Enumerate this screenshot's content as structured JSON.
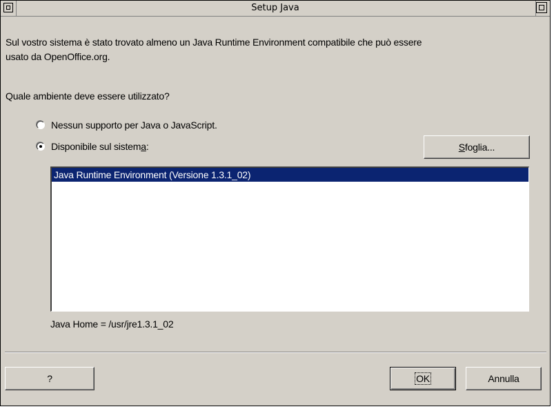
{
  "window": {
    "title": "Setup Java"
  },
  "content": {
    "intro_line1": "Sul vostro sistema è stato trovato almeno un Java Runtime Environment compatibile che può essere",
    "intro_line2": "usato da OpenOffice.org.",
    "question": "Quale ambiente deve essere utilizzato?",
    "options": [
      {
        "label": "Nessun supporto per Java o JavaScript.",
        "checked": false
      },
      {
        "label_prefix": "Disponibile sul sistem",
        "label_accel": "a",
        "label_suffix": ":",
        "checked": true
      }
    ],
    "browse_button": {
      "accel": "S",
      "rest": "foglia..."
    },
    "jre_list": [
      "Java Runtime Environment (Versione 1.3.1_02)"
    ],
    "selected_index": 0,
    "java_home": "Java Home = /usr/jre1.3.1_02"
  },
  "footer": {
    "help_label": "?",
    "ok_label": "OK",
    "cancel_label": "Annulla"
  },
  "colors": {
    "dialog_bg": "#d4d0c8",
    "selection_bg": "#0b2471",
    "selection_fg": "#ffffff"
  },
  "icons": {
    "titlebar_left": "window-menu-icon",
    "titlebar_right": "maximize-icon"
  }
}
